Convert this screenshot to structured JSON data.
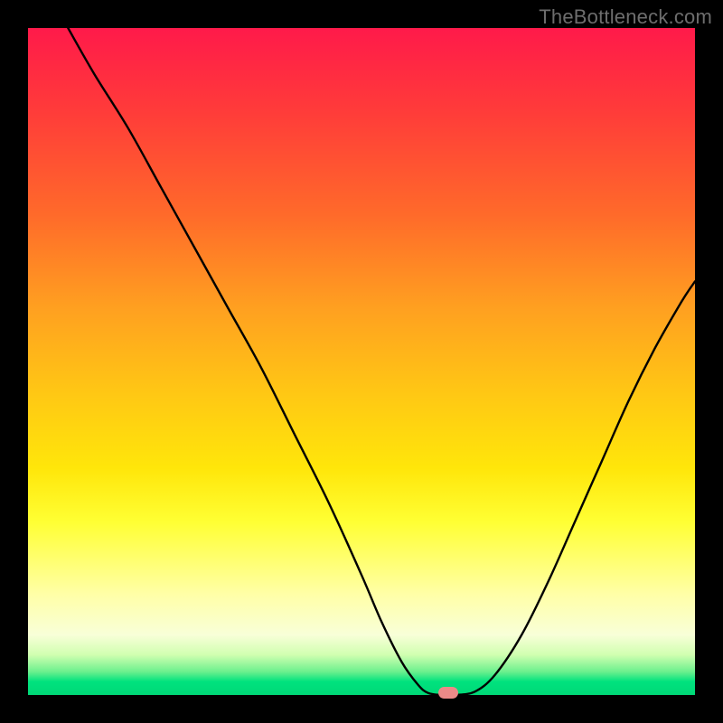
{
  "watermark": "TheBottleneck.com",
  "colors": {
    "frame": "#000000",
    "curve_stroke": "#000000",
    "marker_fill": "#ec8a88",
    "gradient_top": "#ff1a4a",
    "gradient_bottom": "#00d877"
  },
  "chart_data": {
    "type": "line",
    "title": "",
    "xlabel": "",
    "ylabel": "",
    "xlim": [
      0,
      100
    ],
    "ylim": [
      0,
      100
    ],
    "grid": false,
    "legend": false,
    "x": [
      6,
      10,
      15,
      20,
      25,
      30,
      35,
      40,
      45,
      50,
      53,
      56,
      58.5,
      60,
      62,
      64,
      67,
      70,
      74,
      78,
      82,
      86,
      90,
      94,
      98,
      100
    ],
    "y": [
      100,
      93,
      85,
      76,
      67,
      58,
      49,
      39,
      29,
      18,
      11,
      5,
      1.5,
      0.3,
      0,
      0,
      0.5,
      3,
      9,
      17,
      26,
      35,
      44,
      52,
      59,
      62
    ],
    "marker": {
      "x": 63,
      "y": 0.3
    },
    "description": "V-shaped bottleneck curve on red-to-green vertical gradient; minimum (optimal point) highlighted by pink pill marker near x≈63."
  }
}
